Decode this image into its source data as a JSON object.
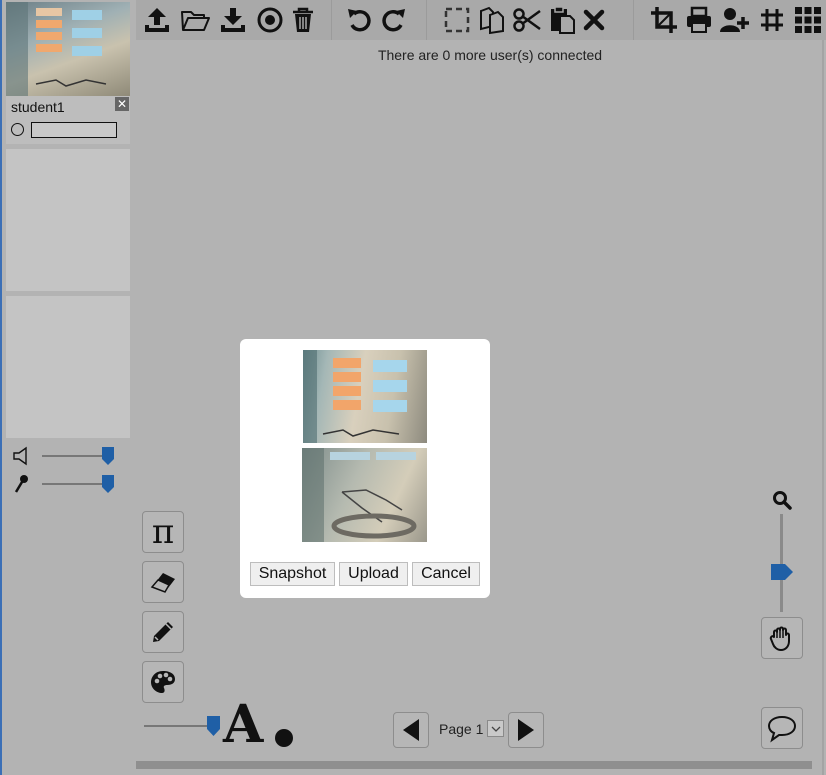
{
  "status": {
    "connected_text": "There are 0 more user(s) connected"
  },
  "students": [
    {
      "name": "student1",
      "close_glyph": "✕"
    }
  ],
  "toolbar": {
    "icons": [
      "upload-icon",
      "open-folder-icon",
      "download-icon",
      "record-icon",
      "trash-icon",
      "undo-icon",
      "redo-icon",
      "select-icon",
      "copy-icon",
      "cut-icon",
      "paste-icon",
      "delete-icon",
      "crop-icon",
      "print-icon",
      "add-user-icon",
      "grid-icon",
      "grid-large-icon"
    ]
  },
  "dialog": {
    "snapshot_label": "Snapshot",
    "upload_label": "Upload",
    "cancel_label": "Cancel"
  },
  "tools": {
    "pi_glyph": "π",
    "font_glyph": "A",
    "line_size_fraction": 0.95
  },
  "pagination": {
    "page_label": "Page 1"
  },
  "audio": {
    "speaker_level": 0.95,
    "mic_level": 0.95
  },
  "zoom": {
    "level_fraction": 0.42
  },
  "colors": {
    "accent": "#1f5fa6",
    "background": "#b3b3b3",
    "toolbar": "#a9a9a9"
  }
}
